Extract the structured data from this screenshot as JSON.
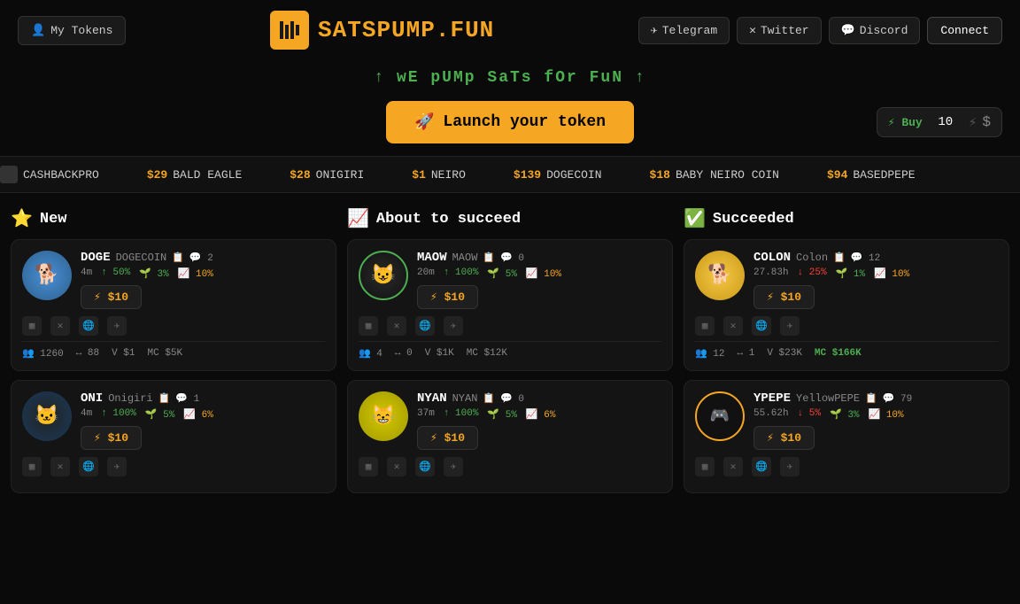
{
  "header": {
    "my_tokens": "My Tokens",
    "logo": "SATSPUMP",
    "logo_suffix": ".FUN",
    "tagline": "↑ wE pUMp SaTs fOr FuN ↑",
    "nav": {
      "telegram": "Telegram",
      "twitter": "Twitter",
      "discord": "Discord",
      "connect": "Connect"
    },
    "buy_label": "⚡ Buy",
    "buy_value": "10",
    "buy_currency": "$"
  },
  "ticker": [
    {
      "name": "CASHBACKPRO",
      "price": ""
    },
    {
      "name": "BALD EAGLE",
      "price": "$29"
    },
    {
      "name": "ONIGIRI",
      "price": "$28"
    },
    {
      "name": "NEIRO",
      "price": "$1"
    },
    {
      "name": "DOGECOIN",
      "price": "$139"
    },
    {
      "name": "BABY NEIRO COIN",
      "price": "$18"
    },
    {
      "name": "BASEDPEPE",
      "price": "$94"
    }
  ],
  "sections": {
    "new": {
      "label": "New",
      "icon": "⭐"
    },
    "about_to_succeed": {
      "label": "About to succeed",
      "icon": "📈"
    },
    "succeeded": {
      "label": "Succeeded",
      "icon": "✅"
    }
  },
  "tokens": {
    "new": [
      {
        "ticker": "DOGE",
        "fullname": "DOGECOIN",
        "comments": "2",
        "time": "4m",
        "holders": "50%",
        "vol1": "3%",
        "vol2": "10%",
        "buy_label": "⚡ $10",
        "holders_count": "1260",
        "txns": "88",
        "volume": "$1",
        "mc": "$5K",
        "emoji": "🐕"
      },
      {
        "ticker": "ONI",
        "fullname": "Onigiri",
        "comments": "1",
        "time": "4m",
        "holders": "100%",
        "vol1": "5%",
        "vol2": "6%",
        "buy_label": "⚡ $10",
        "emoji": "🐱"
      }
    ],
    "about_to_succeed": [
      {
        "ticker": "MAOW",
        "fullname": "MAOW",
        "comments": "0",
        "time": "20m",
        "holders": "100%",
        "vol1": "5%",
        "vol2": "10%",
        "buy_label": "⚡ $10",
        "holders_count": "4",
        "txns": "0",
        "volume": "$1K",
        "mc": "$12K",
        "emoji": "🐱"
      },
      {
        "ticker": "NYAN",
        "fullname": "NYAN",
        "comments": "0",
        "time": "37m",
        "holders": "100%",
        "vol1": "5%",
        "vol2": "6%",
        "buy_label": "⚡ $10",
        "emoji": "🐱"
      }
    ],
    "succeeded": [
      {
        "ticker": "COLON",
        "fullname": "Colon",
        "comments": "12",
        "time": "27.83h",
        "holders": "25%",
        "vol1": "1%",
        "vol2": "10%",
        "buy_label": "⚡ $10",
        "holders_count": "12",
        "txns": "1",
        "volume": "$23K",
        "mc": "$166K",
        "emoji": "🐕",
        "mc_color": "succeeded"
      },
      {
        "ticker": "YPEPE",
        "fullname": "YellowPEPE",
        "comments": "79",
        "time": "55.62h",
        "holders": "5%",
        "vol1": "3%",
        "vol2": "10%",
        "buy_label": "⚡ $10",
        "emoji": "🎮"
      }
    ]
  }
}
